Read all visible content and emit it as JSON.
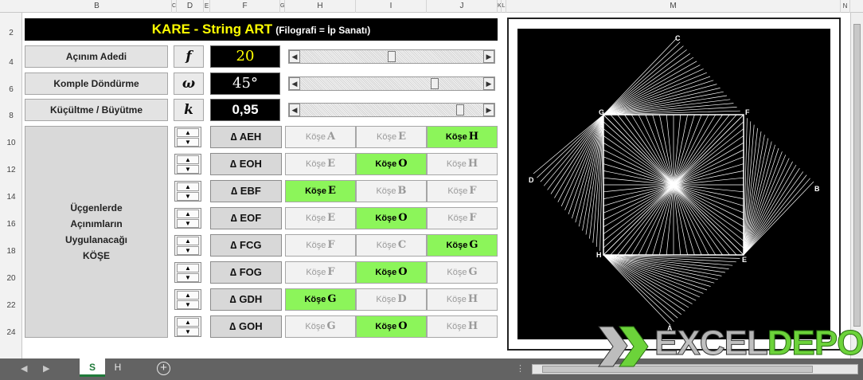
{
  "columns": [
    "B",
    "C",
    "D",
    "E",
    "F",
    "G",
    "H",
    "I",
    "J",
    "K",
    "L",
    "M",
    "N"
  ],
  "rows": [
    "2",
    "4",
    "6",
    "8",
    "10",
    "12",
    "14",
    "16",
    "18",
    "20",
    "22",
    "24"
  ],
  "title": {
    "main": "KARE - String ART",
    "sub": "(Filografi = İp Sanatı)"
  },
  "params": [
    {
      "label": "Açınım Adedi",
      "symbol": "f",
      "value": "20",
      "slider_level": 0.47
    },
    {
      "label": "Komple Döndürme",
      "symbol": "ω",
      "value": "45°",
      "slider_level": 0.75
    },
    {
      "label": "Küçültme / Büyütme",
      "symbol": "k",
      "value": "0,95",
      "slider_level": 0.92
    }
  ],
  "big_label": [
    "Üçgenlerde",
    "Açınımların",
    "Uygulanacağı",
    "KÖŞE"
  ],
  "triangles": [
    {
      "name": "∆ AEH",
      "corners": [
        {
          "label": "Köşe",
          "letter": "A",
          "on": false
        },
        {
          "label": "Köşe",
          "letter": "E",
          "on": false
        },
        {
          "label": "Köşe",
          "letter": "H",
          "on": true
        }
      ]
    },
    {
      "name": "∆ EOH",
      "corners": [
        {
          "label": "Köşe",
          "letter": "E",
          "on": false
        },
        {
          "label": "Köşe",
          "letter": "O",
          "on": true
        },
        {
          "label": "Köşe",
          "letter": "H",
          "on": false
        }
      ]
    },
    {
      "name": "∆ EBF",
      "corners": [
        {
          "label": "Köşe",
          "letter": "E",
          "on": true
        },
        {
          "label": "Köşe",
          "letter": "B",
          "on": false
        },
        {
          "label": "Köşe",
          "letter": "F",
          "on": false
        }
      ]
    },
    {
      "name": "∆ EOF",
      "corners": [
        {
          "label": "Köşe",
          "letter": "E",
          "on": false
        },
        {
          "label": "Köşe",
          "letter": "O",
          "on": true
        },
        {
          "label": "Köşe",
          "letter": "F",
          "on": false
        }
      ]
    },
    {
      "name": "∆ FCG",
      "corners": [
        {
          "label": "Köşe",
          "letter": "F",
          "on": false
        },
        {
          "label": "Köşe",
          "letter": "C",
          "on": false
        },
        {
          "label": "Köşe",
          "letter": "G",
          "on": true
        }
      ]
    },
    {
      "name": "∆ FOG",
      "corners": [
        {
          "label": "Köşe",
          "letter": "F",
          "on": false
        },
        {
          "label": "Köşe",
          "letter": "O",
          "on": true
        },
        {
          "label": "Köşe",
          "letter": "G",
          "on": false
        }
      ]
    },
    {
      "name": "∆ GDH",
      "corners": [
        {
          "label": "Köşe",
          "letter": "G",
          "on": true
        },
        {
          "label": "Köşe",
          "letter": "D",
          "on": false
        },
        {
          "label": "Köşe",
          "letter": "H",
          "on": false
        }
      ]
    },
    {
      "name": "∆ GOH",
      "corners": [
        {
          "label": "Köşe",
          "letter": "G",
          "on": false
        },
        {
          "label": "Köşe",
          "letter": "O",
          "on": true
        },
        {
          "label": "Köşe",
          "letter": "H",
          "on": false
        }
      ]
    }
  ],
  "drawing": {
    "vertex_labels": {
      "A": "A",
      "B": "B",
      "C": "C",
      "D": "D",
      "E": "E",
      "F": "F",
      "G": "G",
      "H": "H"
    }
  },
  "sheets": {
    "active": "S",
    "other": "H"
  },
  "logo": {
    "part1": "EXCEL",
    "part2": "DEPO"
  },
  "colors": {
    "highlight": "#8cf55a",
    "title_text": "#ffff00",
    "value_yellow": "#ffff00"
  }
}
